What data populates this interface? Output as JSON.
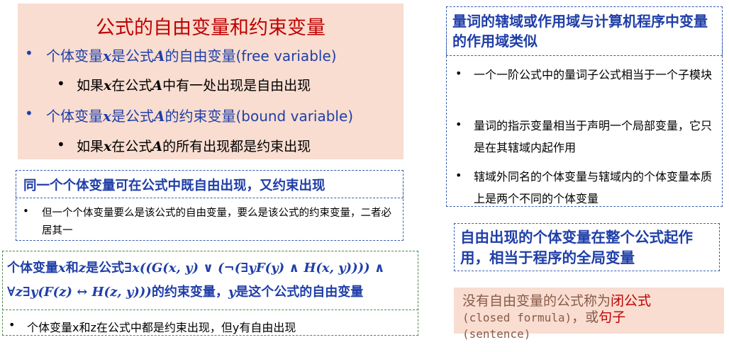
{
  "box1": {
    "title": "公式的自由变量和约束变量",
    "item1": {
      "pre": "个体变量",
      "var": "x",
      "mid": "是公式",
      "var2": "A",
      "post": "的自由变量",
      "en": "(free variable)"
    },
    "item1_sub": {
      "pre": "如果",
      "var": "x",
      "mid": "在公式",
      "var2": "A",
      "post": "中有一处出现是自由出现"
    },
    "item2": {
      "pre": "个体变量",
      "var": "x",
      "mid": "是公式",
      "var2": "A",
      "post": "的约束变量",
      "en": "(bound variable)"
    },
    "item2_sub": {
      "pre": "如果",
      "var": "x",
      "mid": "在公式",
      "var2": "A",
      "post": "的所有出现都是约束出现"
    }
  },
  "box2": {
    "title": "同一个个体变量可在公式中既自由出现，又约束出现",
    "text": "但一个个体变量要么是该公式的自由变量，要么是该公式的约束变量，二者必居其一"
  },
  "box3": {
    "line1_pre": "个体变量",
    "x": "x",
    "and": "和",
    "z": "z",
    "is_formula": "是公式",
    "formula1": "∃x((G(x, y) ∨ (¬(∃yF(y) ∧ H(x, y)))) ∧",
    "formula2": "∀z∃y(F(z) ↔ H(z, y)))",
    "line2_post": "的约束变量，",
    "y": "y",
    "line2_end": "是这个公式的自由变量",
    "sub": "个体变量x和z在公式中都是约束出现，但y有自由出现"
  },
  "box4": {
    "title": "量词的辖域或作用域与计算机程序中变量的作用域类似",
    "items": [
      "一个一阶公式中的量词子公式相当于一个子模块",
      "量词的指示变量相当于声明一个局部变量，它只是在其辖域内起作用",
      "辖域外同名的个体变量与辖域内的个体变量本质上是两个不同的个体变量"
    ]
  },
  "box5": {
    "text": "自由出现的个体变量在整个公式起作用，相当于程序的全局变量"
  },
  "box6": {
    "pre": "没有自由变量的公式称为",
    "closed": "闭公式",
    "closed_en": "(closed formula)",
    "or": "，或",
    "sentence": "句子",
    "sentence_en": "(sentence)"
  },
  "bullet": "•"
}
